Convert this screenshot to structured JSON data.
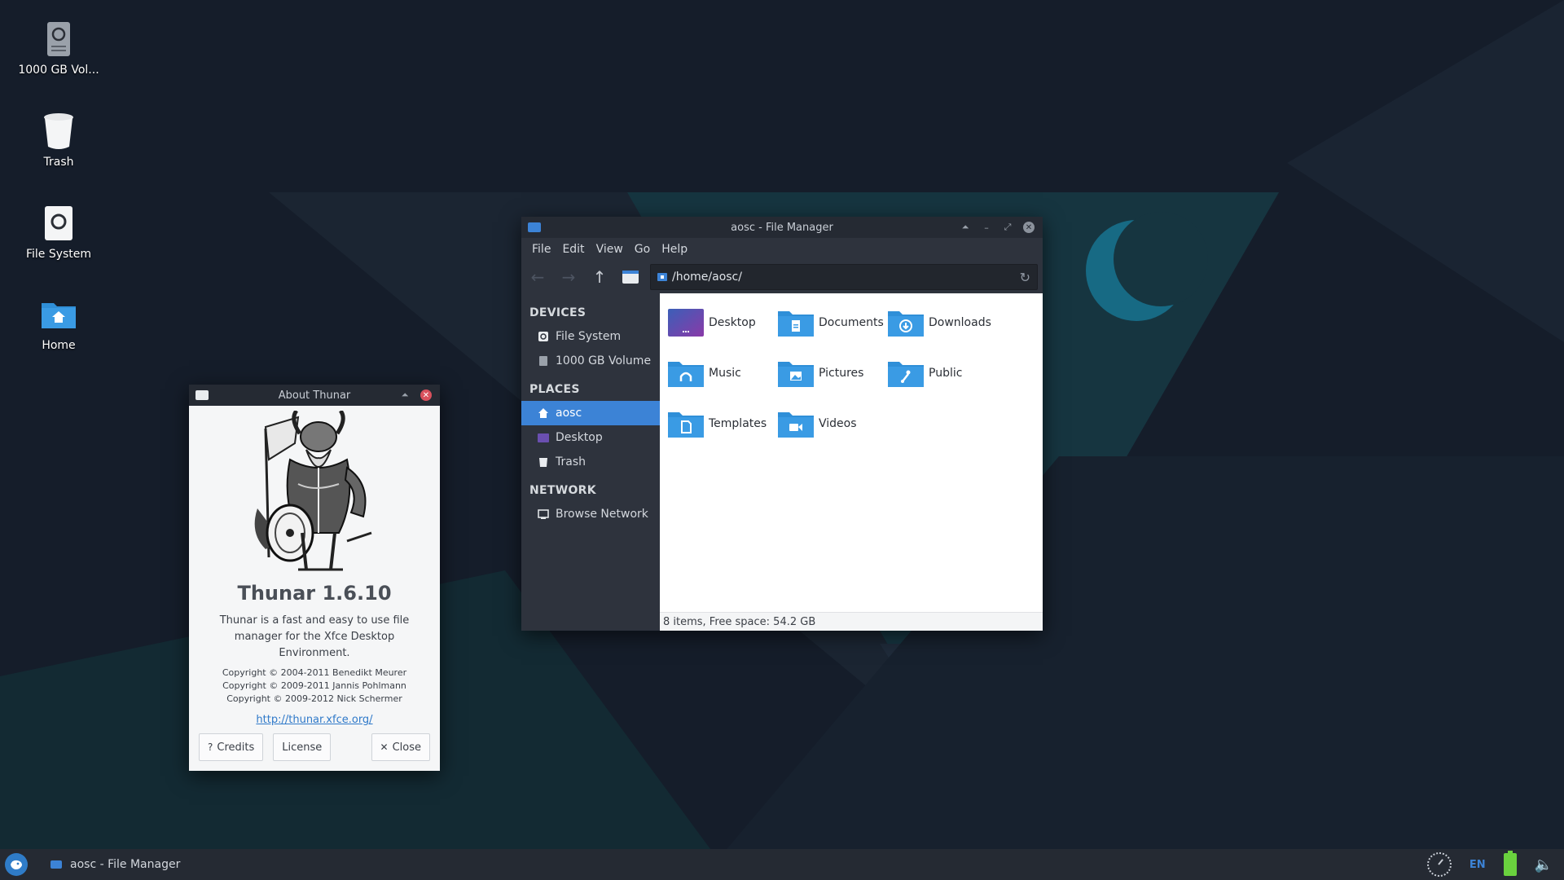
{
  "desktop": {
    "icons": [
      {
        "label": "1000 GB Vol...",
        "icon": "hard-drive-icon"
      },
      {
        "label": "Trash",
        "icon": "trash-icon"
      },
      {
        "label": "File System",
        "icon": "filesystem-drive-icon"
      },
      {
        "label": "Home",
        "icon": "home-folder-icon"
      }
    ]
  },
  "file_manager": {
    "title": "aosc - File Manager",
    "menu": [
      "File",
      "Edit",
      "View",
      "Go",
      "Help"
    ],
    "path": "/home/aosc/",
    "sidebar": {
      "devices_heading": "DEVICES",
      "devices": [
        "File System",
        "1000 GB Volume"
      ],
      "places_heading": "PLACES",
      "places": [
        "aosc",
        "Desktop",
        "Trash"
      ],
      "network_heading": "NETWORK",
      "network": [
        "Browse Network"
      ],
      "selected": "aosc"
    },
    "files": [
      "Desktop",
      "Documents",
      "Downloads",
      "Music",
      "Pictures",
      "Public",
      "Templates",
      "Videos"
    ],
    "status": "8 items, Free space: 54.2 GB"
  },
  "about": {
    "title": "About Thunar",
    "name": "Thunar 1.6.10",
    "description": "Thunar is a fast and easy to use file manager for the Xfce Desktop Environment.",
    "copyright": [
      "Copyright © 2004-2011 Benedikt Meurer",
      "Copyright © 2009-2011 Jannis Pohlmann",
      "Copyright © 2009-2012 Nick Schermer"
    ],
    "link": "http://thunar.xfce.org/",
    "buttons": {
      "credits": "Credits",
      "license": "License",
      "close": "Close"
    }
  },
  "taskbar": {
    "task_label": "aosc - File Manager",
    "lang": "EN"
  },
  "colors": {
    "accent": "#3c83d6",
    "folder": "#2f8fd8",
    "battery": "#6ad13e",
    "close_red": "#d9515d"
  }
}
